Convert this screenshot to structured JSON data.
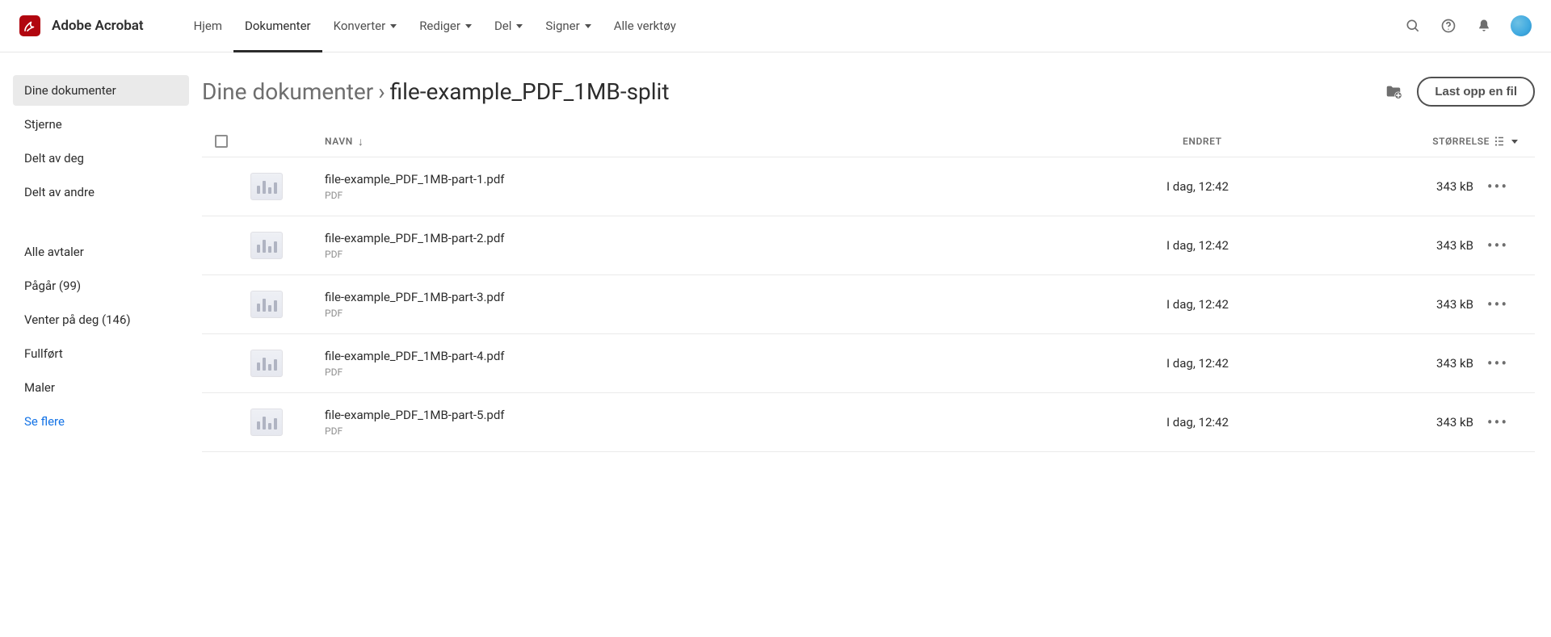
{
  "brand": "Adobe Acrobat",
  "nav": {
    "items": [
      {
        "label": "Hjem",
        "dropdown": false,
        "active": false
      },
      {
        "label": "Dokumenter",
        "dropdown": false,
        "active": true
      },
      {
        "label": "Konverter",
        "dropdown": true,
        "active": false
      },
      {
        "label": "Rediger",
        "dropdown": true,
        "active": false
      },
      {
        "label": "Del",
        "dropdown": true,
        "active": false
      },
      {
        "label": "Signer",
        "dropdown": true,
        "active": false
      },
      {
        "label": "Alle verktøy",
        "dropdown": false,
        "active": false
      }
    ]
  },
  "sidebar": {
    "group1": [
      {
        "label": "Dine dokumenter",
        "active": true
      },
      {
        "label": "Stjerne",
        "active": false
      },
      {
        "label": "Delt av deg",
        "active": false
      },
      {
        "label": "Delt av andre",
        "active": false
      }
    ],
    "group2": [
      {
        "label": "Alle avtaler",
        "active": false
      },
      {
        "label": "Pågår (99)",
        "active": false
      },
      {
        "label": "Venter på deg (146)",
        "active": false
      },
      {
        "label": "Fullført",
        "active": false
      },
      {
        "label": "Maler",
        "active": false
      }
    ],
    "more_label": "Se flere"
  },
  "page": {
    "breadcrumb_root": "Dine dokumenter",
    "breadcrumb_current": "file-example_PDF_1MB-split",
    "upload_label": "Last opp en fil"
  },
  "table": {
    "col_name": "NAVN",
    "col_date": "ENDRET",
    "col_size": "STØRRELSE",
    "rows": [
      {
        "name": "file-example_PDF_1MB-part-1.pdf",
        "type": "PDF",
        "date": "I dag, 12:42",
        "size": "343 kB"
      },
      {
        "name": "file-example_PDF_1MB-part-2.pdf",
        "type": "PDF",
        "date": "I dag, 12:42",
        "size": "343 kB"
      },
      {
        "name": "file-example_PDF_1MB-part-3.pdf",
        "type": "PDF",
        "date": "I dag, 12:42",
        "size": "343 kB"
      },
      {
        "name": "file-example_PDF_1MB-part-4.pdf",
        "type": "PDF",
        "date": "I dag, 12:42",
        "size": "343 kB"
      },
      {
        "name": "file-example_PDF_1MB-part-5.pdf",
        "type": "PDF",
        "date": "I dag, 12:42",
        "size": "343 kB"
      }
    ]
  }
}
